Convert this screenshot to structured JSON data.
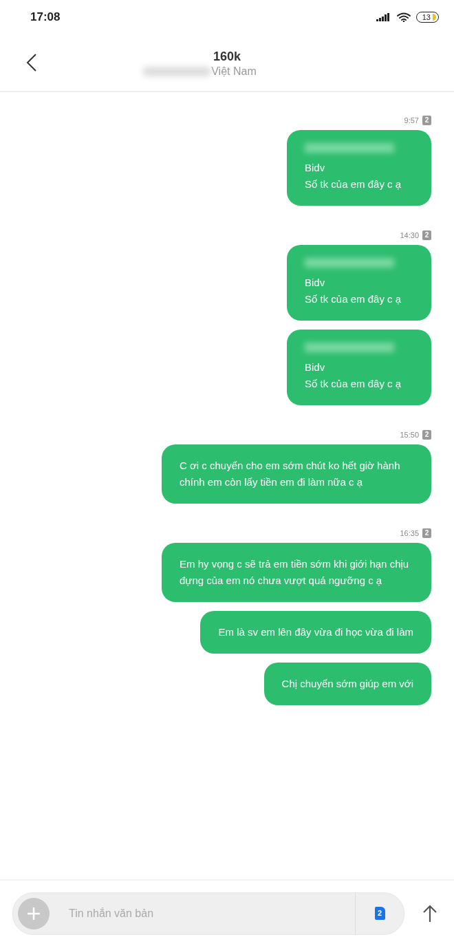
{
  "status_bar": {
    "time": "17:08",
    "battery": "13"
  },
  "header": {
    "title": "160k",
    "subtitle_redacted": true,
    "subtitle": "Việt Nam"
  },
  "groups": [
    {
      "time": "9:57",
      "sim": "2",
      "messages": [
        {
          "redacted": true,
          "text": "Bidv\nSố tk của em đây c ạ"
        }
      ]
    },
    {
      "time": "14:30",
      "sim": "2",
      "messages": [
        {
          "redacted": true,
          "text": "Bidv\nSố tk của em đây c ạ"
        },
        {
          "redacted": true,
          "text": "Bidv\nSố tk của em đây c ạ"
        }
      ]
    },
    {
      "time": "15:50",
      "sim": "2",
      "messages": [
        {
          "redacted": false,
          "text": "C ơi c chuyển cho em sớm chút ko hết giờ hành chính em còn lấy tiền em đi làm nữa c ạ"
        }
      ]
    },
    {
      "time": "16:35",
      "sim": "2",
      "messages": [
        {
          "redacted": false,
          "text": "Em hy vọng c sẽ trả em tiền sớm khi giới hạn chịu đựng của em nó chưa vượt quá ngưỡng c ạ"
        },
        {
          "redacted": false,
          "text": "Em là sv em lên đây vừa đi học vừa đi làm"
        },
        {
          "redacted": false,
          "text": "Chị chuyển sớm giúp em với"
        }
      ]
    }
  ],
  "composer": {
    "placeholder": "Tin nhắn văn bản",
    "sim": "2"
  }
}
